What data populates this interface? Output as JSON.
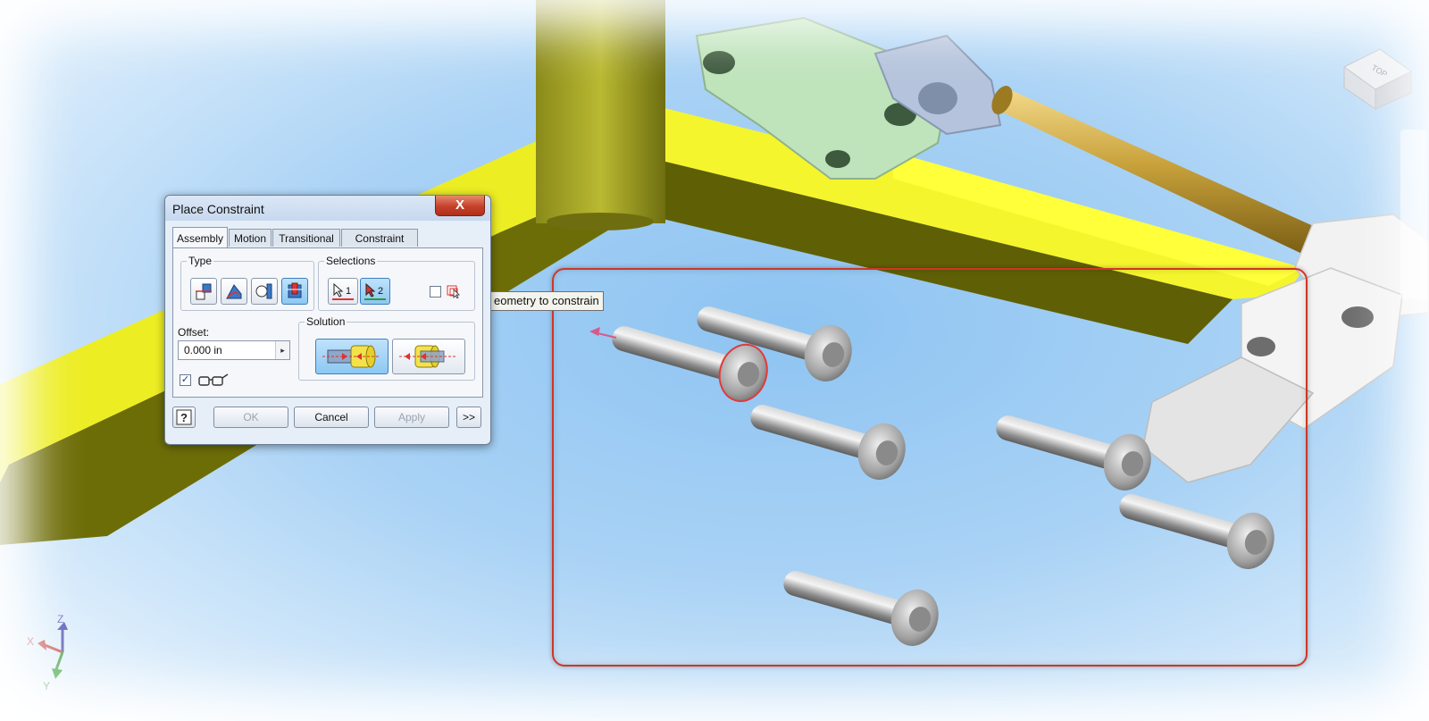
{
  "dialog": {
    "title": "Place Constraint",
    "close_label": "X",
    "tabs": [
      {
        "label": "Assembly",
        "active": true
      },
      {
        "label": "Motion",
        "active": false
      },
      {
        "label": "Transitional",
        "active": false
      },
      {
        "label": "Constraint Set",
        "active": false
      }
    ],
    "type_group": {
      "label": "Type",
      "buttons": [
        {
          "icon": "mate-constraint-icon",
          "selected": false
        },
        {
          "icon": "angle-constraint-icon",
          "selected": false
        },
        {
          "icon": "tangent-constraint-icon",
          "selected": false
        },
        {
          "icon": "insert-constraint-icon",
          "selected": true
        }
      ]
    },
    "selections_group": {
      "label": "Selections",
      "select1_label": "1",
      "select2_label": "2",
      "select2_active": true,
      "pick_part_first_checked": false
    },
    "offset": {
      "label": "Offset:",
      "value": "0.000 in"
    },
    "solution_group": {
      "label": "Solution",
      "opposed_selected": true
    },
    "show_preview_checked": true,
    "buttons": {
      "ok": "OK",
      "cancel": "Cancel",
      "apply": "Apply",
      "more": ">>"
    }
  },
  "tooltip": "eometry to constrain",
  "viewcube_label": "TOP",
  "triad": {
    "x": "X",
    "y": "Y",
    "z": "Z"
  },
  "colors": {
    "frame_yellow": "#eded24",
    "selection_box": "#d03626",
    "selected_button": "#8cc8f2"
  }
}
